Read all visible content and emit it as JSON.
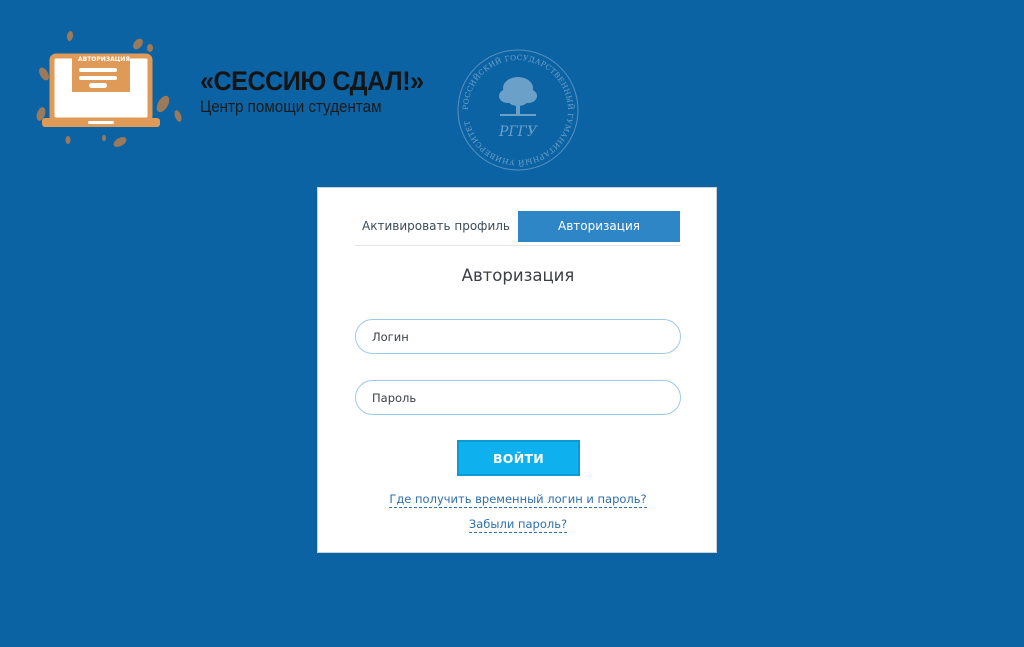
{
  "logo": {
    "title": "«СЕССИЮ СДАЛ!»",
    "subtitle": "Центр помощи студентам",
    "mock_screen_title": "АВТОРИЗАЦИЯ",
    "accent_color": "#e09a58",
    "dark_color": "#141414"
  },
  "seal": {
    "ring_text": "РОССИЙСКИЙ ГОСУДАРСТВЕННЫЙ ГУМАНИТАРНЫЙ УНИВЕРСИТЕТ",
    "monogram": "РГГУ"
  },
  "tabs": {
    "activate_label": "Активировать профиль",
    "auth_label": "Авторизация",
    "active": "auth"
  },
  "form": {
    "title": "Авторизация",
    "login_placeholder": "Логин",
    "password_placeholder": "Пароль",
    "submit_label": "ВОЙТИ"
  },
  "links": {
    "temp_credentials": "Где получить временный логин и пароль?",
    "forgot_password": "Забыли пароль?"
  },
  "colors": {
    "background": "#0c63a4",
    "tab_active": "#2f86c6",
    "button": "#0fb0ee",
    "link": "#2e6eaa"
  }
}
